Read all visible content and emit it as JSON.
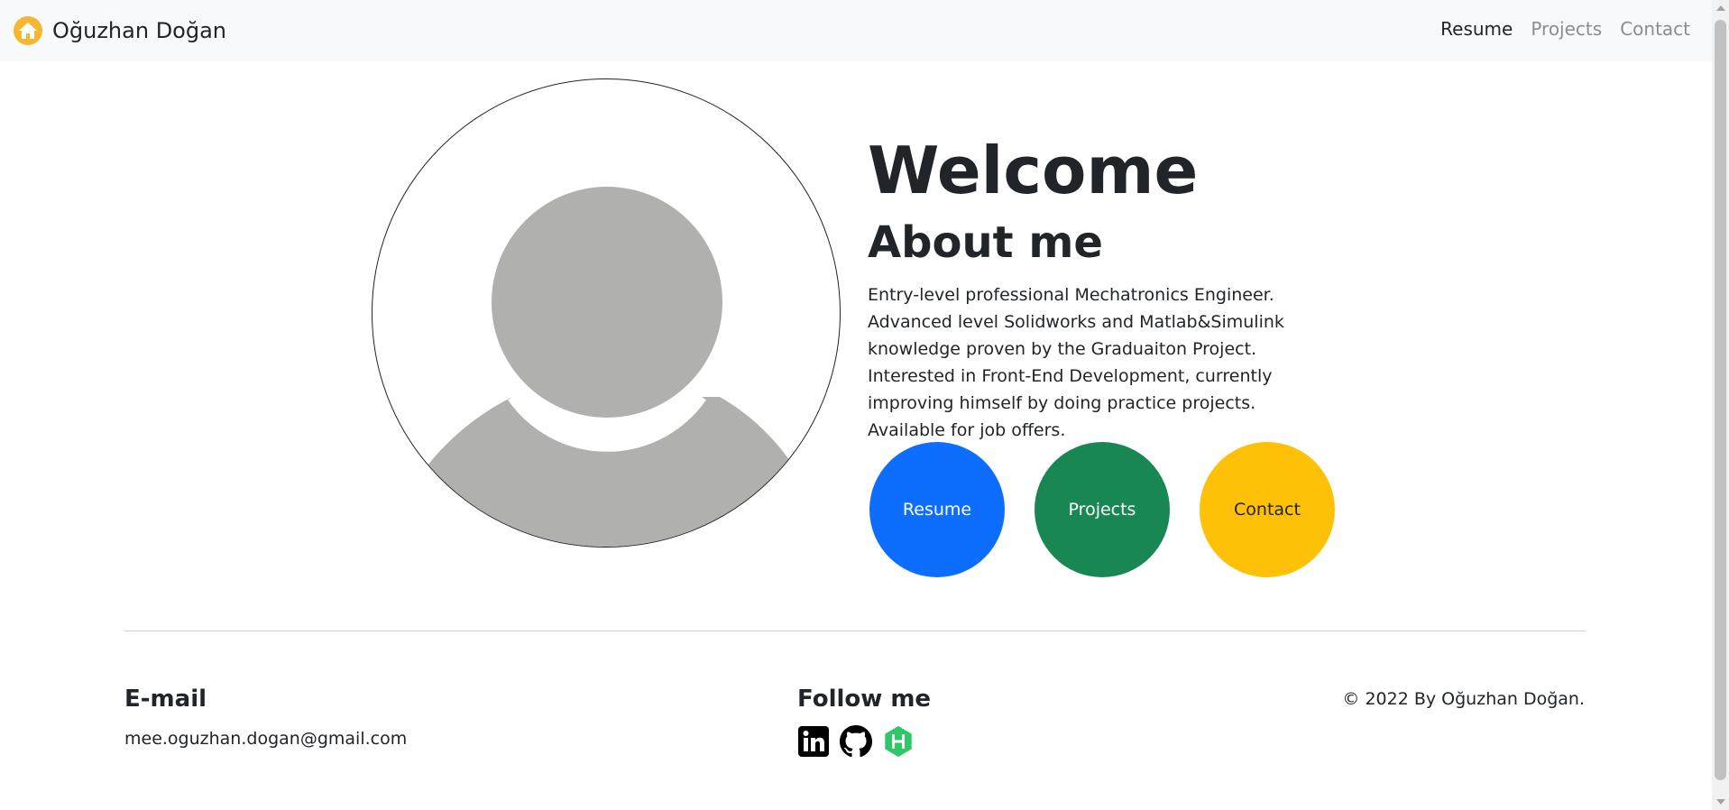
{
  "navbar": {
    "brand": "Oğuzhan Doğan",
    "brand_icon": "home-icon",
    "links": [
      {
        "label": "Resume",
        "active": true
      },
      {
        "label": "Projects",
        "active": false
      },
      {
        "label": "Contact",
        "active": false
      }
    ]
  },
  "hero": {
    "avatar_icon": "user-silhouette-icon",
    "title": "Welcome",
    "about_title": "About me",
    "about_body": "Entry-level professional Mechatronics Engineer. Advanced level Solidworks and Matlab&Simulink knowledge proven by the Graduaiton Project. Interested in Front-End Development, currently improving himself by doing practice projects. Available for job offers.",
    "buttons": [
      {
        "label": "Resume",
        "color": "#0d6efd"
      },
      {
        "label": "Projects",
        "color": "#198754"
      },
      {
        "label": "Contact",
        "color": "#ffc107"
      }
    ]
  },
  "footer": {
    "email_title": "E-mail",
    "email": "mee.oguzhan.dogan@gmail.com",
    "follow_title": "Follow me",
    "social_icons": [
      "linkedin-icon",
      "github-icon",
      "hackerrank-icon"
    ],
    "copyright": "© 2022 By Oğuzhan Doğan."
  },
  "colors": {
    "navbar_bg": "#f8f9fa",
    "brand_icon": "#f4b731",
    "hackerrank": "#2ec866"
  }
}
